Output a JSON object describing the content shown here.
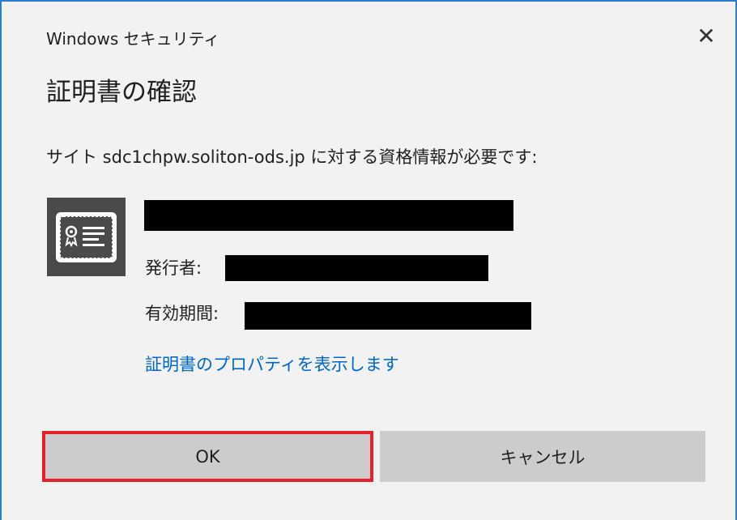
{
  "window": {
    "title": "Windows セキュリティ",
    "close_glyph": "✕"
  },
  "dialog": {
    "heading": "証明書の確認",
    "site_message": "サイト sdc1chpw.soliton-ods.jp に対する資格情報が必要です:",
    "certificate": {
      "icon": "certificate-icon",
      "name_redacted": true,
      "issuer_label": "発行者:",
      "issuer_redacted": true,
      "validity_label": "有効期間:",
      "validity_redacted": true
    },
    "properties_link": "証明書のプロパティを表示します",
    "buttons": {
      "ok": "OK",
      "cancel": "キャンセル"
    }
  },
  "colors": {
    "dialog_bg": "#f2f2f2",
    "window_border": "#2b7bd1",
    "link": "#0066cc",
    "button_bg": "#cccccc",
    "highlight": "#e8202a",
    "icon_bg": "#4a4a4a",
    "redaction": "#000000"
  }
}
